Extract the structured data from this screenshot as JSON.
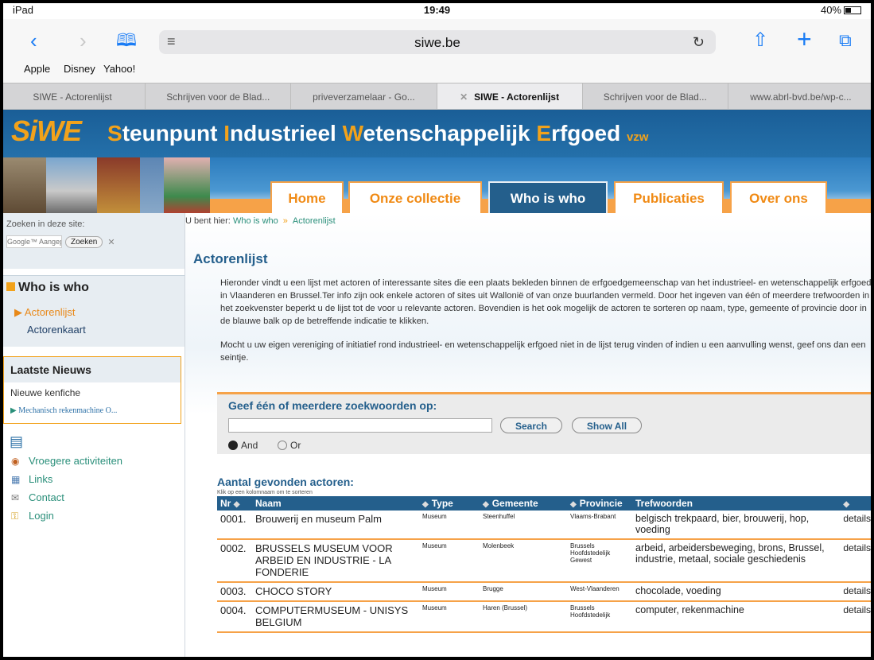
{
  "status": {
    "device": "iPad",
    "time": "19:49",
    "battery": "40%"
  },
  "toolbar": {
    "url": "siwe.be"
  },
  "favorites": [
    "Apple",
    "Disney",
    "Yahoo!"
  ],
  "tabs": [
    {
      "label": "SIWE - Actorenlijst",
      "active": false
    },
    {
      "label": "Schrijven voor de Blad...",
      "active": false
    },
    {
      "label": "priveverzamelaar - Go...",
      "active": false
    },
    {
      "label": "SIWE - Actorenlijst",
      "active": true
    },
    {
      "label": "Schrijven voor de Blad...",
      "active": false
    },
    {
      "label": "www.abrl-bvd.be/wp-c...",
      "active": false
    }
  ],
  "site": {
    "logo": "SiWE",
    "title_parts": [
      "S",
      "teunpunt ",
      "I",
      "ndustrieel ",
      "W",
      "etenschappelijk ",
      "E",
      "rfgoed"
    ],
    "title_suffix": "vzw",
    "nav": [
      "Home",
      "Onze collectie",
      "Who is who",
      "Publicaties",
      "Over ons"
    ],
    "nav_active": "Who is who"
  },
  "sidebar": {
    "search_label": "Zoeken in deze site:",
    "search_placeholder": "Google™ Aangepast z",
    "search_button": "Zoeken",
    "section_title": "Who is who",
    "links": [
      "Actorenlijst",
      "Actorenkaart"
    ],
    "news_title": "Laatste Nieuws",
    "news_item": "Nieuwe kenfiche",
    "news_more": "Mechanisch rekenmachine O...",
    "menu": [
      "Vroegere activiteiten",
      "Links",
      "Contact",
      "Login"
    ]
  },
  "breadcrumb": {
    "prefix": "U bent hier:",
    "items": [
      "Who is who",
      "Actorenlijst"
    ]
  },
  "page": {
    "title": "Actorenlijst",
    "intro1": "Hieronder vindt u een lijst met actoren of interessante sites die een plaats bekleden binnen de erfgoedgemeenschap van het industrieel- en wetenschappelijk erfgoed in Vlaanderen en Brussel.Ter info zijn ook enkele actoren of sites uit Wallonië of van onze buurlanden vermeld. Door het ingeven van één of meerdere trefwoorden in het zoekvenster beperkt u de lijst tot de voor u relevante actoren. Bovendien is het ook mogelijk de actoren te sorteren op naam, type, gemeente of provincie door in de blauwe balk op de betreffende indicatie te klikken.",
    "intro2": "Mocht u uw eigen vereniging of initiatief rond industrieel- en wetenschappelijk erfgoed niet in de lijst terug vinden of indien u een aanvulling wenst, geef ons dan een seintje."
  },
  "search": {
    "label": "Geef één of meerdere zoekwoorden op:",
    "search_button": "Search",
    "showall_button": "Show All",
    "option_and": "And",
    "option_or": "Or"
  },
  "results": {
    "title": "Aantal gevonden actoren:",
    "hint": "Klik op een kolomnaam om te sorteren",
    "columns": [
      "Nr",
      "Naam",
      "Type",
      "Gemeente",
      "Provincie",
      "Trefwoorden"
    ],
    "rows": [
      {
        "nr": "0001.",
        "naam": "Brouwerij en museum Palm",
        "type": "Museum",
        "gemeente": "Steenhuffel",
        "provincie": "Vlaams-Brabant",
        "trefwoorden": "belgisch trekpaard, bier, brouwerij, hop, voeding",
        "details": "details"
      },
      {
        "nr": "0002.",
        "naam": "BRUSSELS MUSEUM VOOR ARBEID EN INDUSTRIE - LA FONDERIE",
        "type": "Museum",
        "gemeente": "Molenbeek",
        "provincie": "Brussels Hoofdstedelijk Gewest",
        "trefwoorden": "arbeid, arbeidersbeweging, brons, Brussel, industrie, metaal, sociale geschiedenis",
        "details": "details"
      },
      {
        "nr": "0003.",
        "naam": "CHOCO STORY",
        "type": "Museum",
        "gemeente": "Brugge",
        "provincie": "West-Vlaanderen",
        "trefwoorden": "chocolade, voeding",
        "details": "details"
      },
      {
        "nr": "0004.",
        "naam": "COMPUTERMUSEUM - UNISYS BELGIUM",
        "type": "Museum",
        "gemeente": "Haren (Brussel)",
        "provincie": "Brussels Hoofdstedelijk",
        "trefwoorden": "computer, rekenmachine",
        "details": "details"
      }
    ]
  }
}
